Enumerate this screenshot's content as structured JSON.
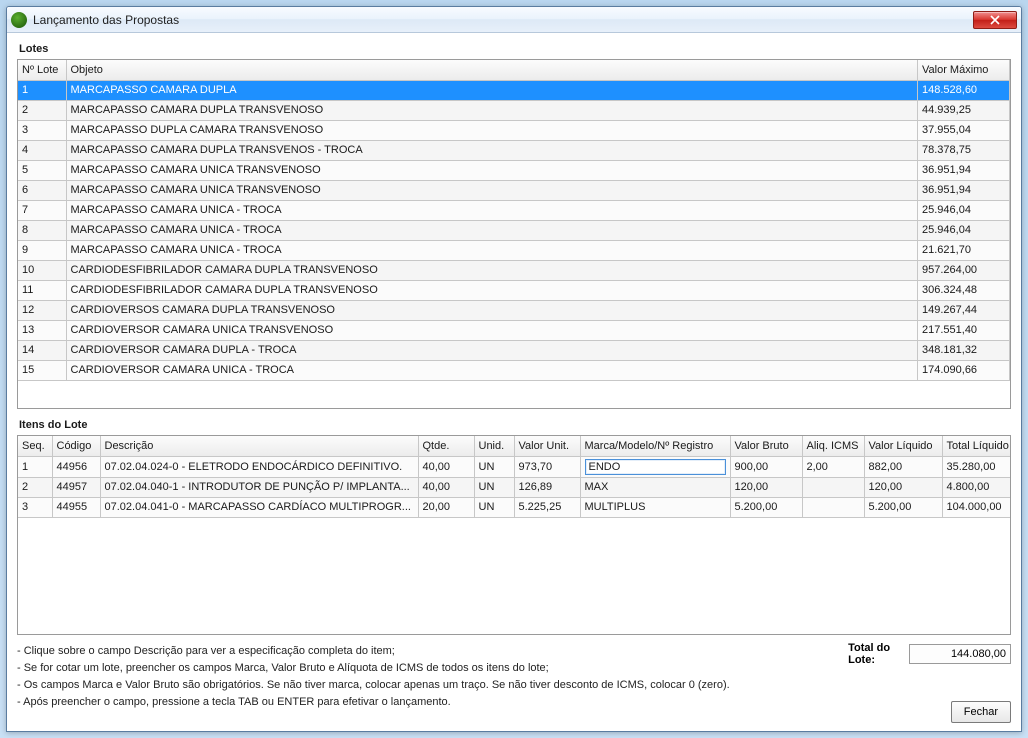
{
  "window": {
    "title": "Lançamento das Propostas"
  },
  "lotes": {
    "title": "Lotes",
    "headers": {
      "num": "Nº Lote",
      "objeto": "Objeto",
      "valor": "Valor Máximo"
    },
    "rows": [
      {
        "num": "1",
        "objeto": "MARCAPASSO CAMARA DUPLA",
        "valor": "148.528,60",
        "selected": true
      },
      {
        "num": "2",
        "objeto": "MARCAPASSO CAMARA DUPLA TRANSVENOSO",
        "valor": "44.939,25"
      },
      {
        "num": "3",
        "objeto": "MARCAPASSO DUPLA CAMARA TRANSVENOSO",
        "valor": "37.955,04"
      },
      {
        "num": "4",
        "objeto": "MARCAPASSO CAMARA DUPLA TRANSVENOS - TROCA",
        "valor": "78.378,75"
      },
      {
        "num": "5",
        "objeto": "MARCAPASSO CAMARA UNICA TRANSVENOSO",
        "valor": "36.951,94"
      },
      {
        "num": "6",
        "objeto": "MARCAPASSO CAMARA UNICA TRANSVENOSO",
        "valor": "36.951,94"
      },
      {
        "num": "7",
        "objeto": "MARCAPASSO CAMARA UNICA - TROCA",
        "valor": "25.946,04"
      },
      {
        "num": "8",
        "objeto": "MARCAPASSO CAMARA UNICA - TROCA",
        "valor": "25.946,04"
      },
      {
        "num": "9",
        "objeto": "MARCAPASSO CAMARA UNICA - TROCA",
        "valor": "21.621,70"
      },
      {
        "num": "10",
        "objeto": "CARDIODESFIBRILADOR CAMARA DUPLA TRANSVENOSO",
        "valor": "957.264,00"
      },
      {
        "num": "11",
        "objeto": "CARDIODESFIBRILADOR CAMARA DUPLA TRANSVENOSO",
        "valor": "306.324,48"
      },
      {
        "num": "12",
        "objeto": "CARDIOVERSOS CAMARA DUPLA TRANSVENOSO",
        "valor": "149.267,44"
      },
      {
        "num": "13",
        "objeto": "CARDIOVERSOR CAMARA UNICA TRANSVENOSO",
        "valor": "217.551,40"
      },
      {
        "num": "14",
        "objeto": "CARDIOVERSOR CAMARA DUPLA - TROCA",
        "valor": "348.181,32"
      },
      {
        "num": "15",
        "objeto": "CARDIOVERSOR CAMARA UNICA - TROCA",
        "valor": "174.090,66"
      }
    ]
  },
  "itens": {
    "title": "Itens do Lote",
    "headers": {
      "seq": "Seq.",
      "codigo": "Código",
      "descricao": "Descrição",
      "qtde": "Qtde.",
      "unid": "Unid.",
      "valorUnit": "Valor Unit.",
      "marca": "Marca/Modelo/Nº Registro",
      "valorBruto": "Valor Bruto",
      "aliq": "Aliq. ICMS",
      "valorLiq": "Valor Líquido",
      "totalLiq": "Total Líquido"
    },
    "rows": [
      {
        "seq": "1",
        "codigo": "44956",
        "descricao": "07.02.04.024-0 - ELETRODO ENDOCÁRDICO DEFINITIVO.",
        "qtde": "40,00",
        "unid": "UN",
        "valorUnit": "973,70",
        "marca": "ENDO",
        "valorBruto": "900,00",
        "aliq": "2,00",
        "valorLiq": "882,00",
        "totalLiq": "35.280,00"
      },
      {
        "seq": "2",
        "codigo": "44957",
        "descricao": "07.02.04.040-1 - INTRODUTOR DE PUNÇÃO P/ IMPLANTA...",
        "qtde": "40,00",
        "unid": "UN",
        "valorUnit": "126,89",
        "marca": "MAX",
        "valorBruto": "120,00",
        "aliq": "",
        "valorLiq": "120,00",
        "totalLiq": "4.800,00"
      },
      {
        "seq": "3",
        "codigo": "44955",
        "descricao": "07.02.04.041-0 - MARCAPASSO CARDÍACO MULTIPROGR...",
        "qtde": "20,00",
        "unid": "UN",
        "valorUnit": "5.225,25",
        "marca": "MULTIPLUS",
        "valorBruto": "5.200,00",
        "aliq": "",
        "valorLiq": "5.200,00",
        "totalLiq": "104.000,00"
      }
    ]
  },
  "footer": {
    "hints": [
      "- Clique sobre o campo Descrição para ver a especificação completa do item;",
      "- Se for cotar um lote, preencher os campos Marca, Valor Bruto e Alíquota de ICMS de todos os itens do lote;",
      "- Os campos Marca e Valor Bruto são obrigatórios. Se não tiver marca, colocar apenas um traço. Se não tiver desconto de ICMS, colocar 0 (zero).",
      "- Após preencher o campo, pressione a tecla TAB ou ENTER para efetivar o lançamento."
    ],
    "totalLabel": "Total do Lote:",
    "totalValue": "144.080,00",
    "closeBtn": "Fechar"
  }
}
